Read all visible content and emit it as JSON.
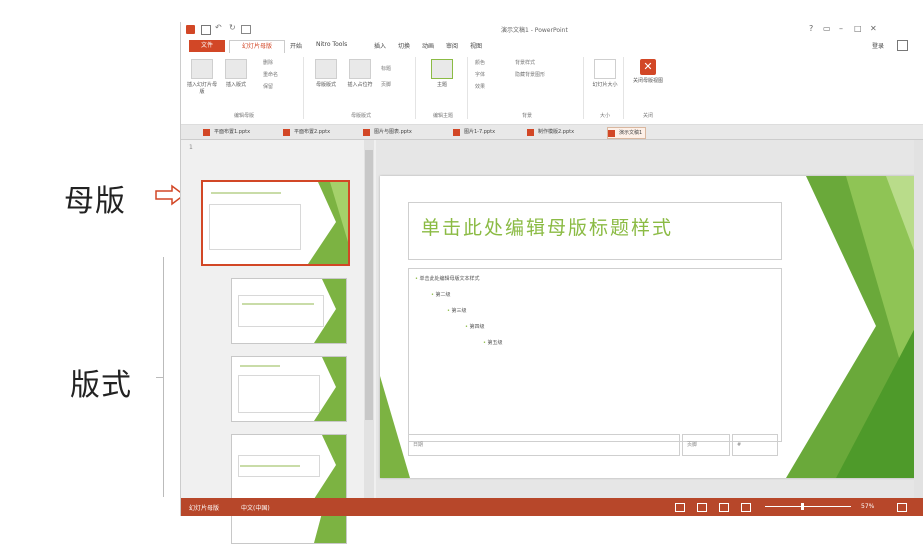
{
  "annotations": {
    "master": "母版",
    "layout": "版式"
  },
  "window": {
    "title": "演示文稿1 - PowerPoint",
    "help": "?",
    "restore": "▭",
    "minimize": "–",
    "maximize": "□",
    "close": "✕",
    "account": "登录"
  },
  "ribbon_tabs": [
    "文件",
    "幻灯片母版",
    "开始",
    "Nitro Tools",
    "插入",
    "切换",
    "动画",
    "审阅",
    "视图"
  ],
  "ribbon": {
    "groups": [
      {
        "label": "编辑母版",
        "buttons": [
          "插入幻灯片母版",
          "插入版式"
        ],
        "small": [
          "删除",
          "重命名",
          "保留"
        ]
      },
      {
        "label": "母版版式",
        "buttons": [
          "母版版式",
          "插入占位符"
        ],
        "small": [
          "标题",
          "页脚"
        ]
      },
      {
        "label": "编辑主题",
        "buttons": [
          "主题"
        ],
        "small": []
      },
      {
        "label": "背景",
        "buttons": [],
        "small": [
          "颜色",
          "字体",
          "效果",
          "背景样式",
          "隐藏背景图形"
        ]
      },
      {
        "label": "大小",
        "buttons": [
          "幻灯片大小"
        ],
        "small": []
      },
      {
        "label": "关闭",
        "buttons": [
          "关闭母版视图"
        ],
        "small": []
      }
    ]
  },
  "file_tabs": [
    "平面布置1.pptx",
    "平面布置2.pptx",
    "图片与图表.pptx",
    "图片1-7.pptx",
    "制作模版2.pptx",
    "演示文稿1"
  ],
  "thumbnails": {
    "numbers": [
      "1",
      "",
      "",
      "",
      ""
    ]
  },
  "slide": {
    "title": "单击此处编辑母版标题样式",
    "levels": [
      "单击此处编辑母版文本样式",
      "第二级",
      "第三级",
      "第四级",
      "第五级"
    ],
    "footer_date": "日期",
    "footer_text": "页脚",
    "footer_num": "#"
  },
  "status": {
    "mode": "幻灯片母版",
    "language": "中文(中国)",
    "zoom": "57%"
  },
  "colors": {
    "accent": "#d24726",
    "green": "#8bbb44",
    "status_bar": "#b7472a"
  }
}
